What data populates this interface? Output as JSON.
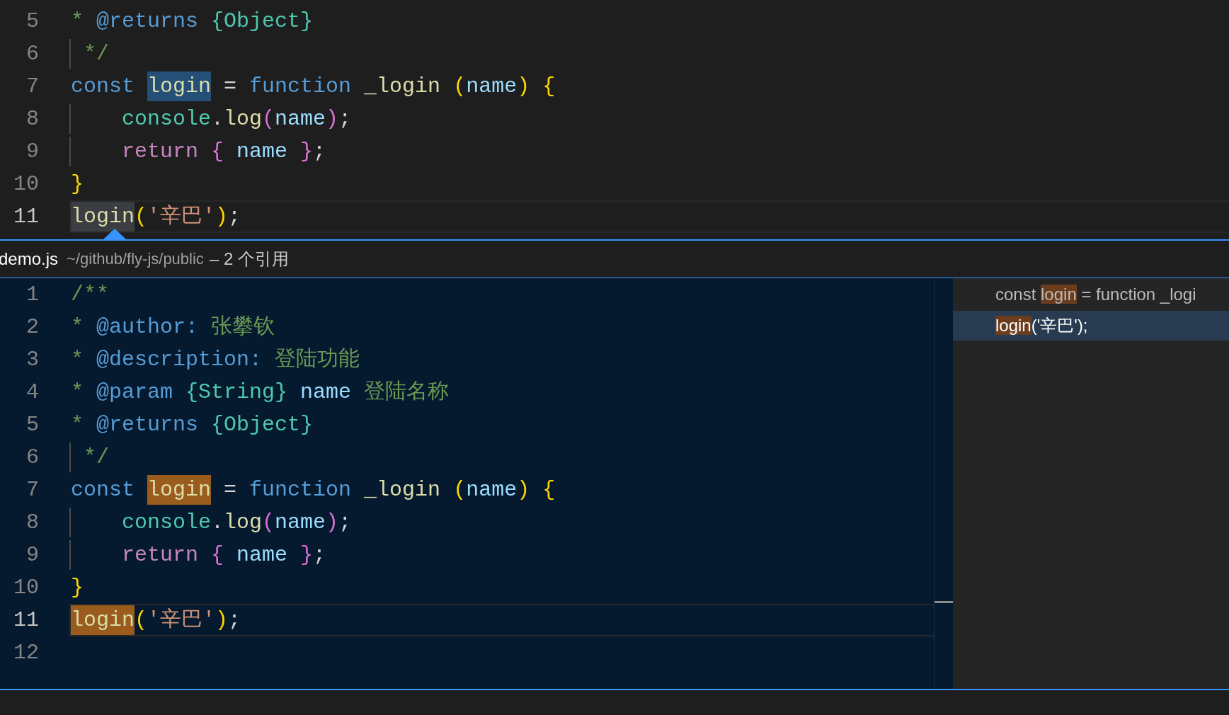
{
  "editor": {
    "lines": [
      {
        "number": "5",
        "current": false,
        "guide": false,
        "tokens": [
          {
            "text": "* ",
            "kind": "comment"
          },
          {
            "text": "@returns",
            "kind": "tag"
          },
          {
            "text": " {Object}",
            "kind": "type"
          }
        ]
      },
      {
        "number": "6",
        "current": false,
        "guide": true,
        "tokens": [
          {
            "text": " */",
            "kind": "comment"
          }
        ]
      },
      {
        "number": "7",
        "current": false,
        "guide": false,
        "tokens": [
          {
            "text": "const ",
            "kind": "keyword"
          },
          {
            "text": "login",
            "kind": "function",
            "selected": true
          },
          {
            "text": " = ",
            "kind": "plain"
          },
          {
            "text": "function ",
            "kind": "keyword"
          },
          {
            "text": "_login ",
            "kind": "function"
          },
          {
            "text": "(",
            "kind": "bracket1"
          },
          {
            "text": "name",
            "kind": "variable"
          },
          {
            "text": ") {",
            "kind": "bracket1"
          }
        ]
      },
      {
        "number": "8",
        "current": false,
        "guide": true,
        "tokens": [
          {
            "text": "    console",
            "kind": "class"
          },
          {
            "text": ".",
            "kind": "plain"
          },
          {
            "text": "log",
            "kind": "function"
          },
          {
            "text": "(",
            "kind": "bracket2"
          },
          {
            "text": "name",
            "kind": "variable"
          },
          {
            "text": ")",
            "kind": "bracket2"
          },
          {
            "text": ";",
            "kind": "plain"
          }
        ]
      },
      {
        "number": "9",
        "current": false,
        "guide": true,
        "tokens": [
          {
            "text": "    return ",
            "kind": "control"
          },
          {
            "text": "{ ",
            "kind": "bracket2"
          },
          {
            "text": "name ",
            "kind": "variable"
          },
          {
            "text": "}",
            "kind": "bracket2"
          },
          {
            "text": ";",
            "kind": "plain"
          }
        ]
      },
      {
        "number": "10",
        "current": false,
        "guide": false,
        "tokens": [
          {
            "text": "}",
            "kind": "bracket1"
          }
        ]
      },
      {
        "number": "11",
        "current": true,
        "guide": false,
        "tokens": [
          {
            "text": "login",
            "kind": "function",
            "highlighted": true
          },
          {
            "text": "(",
            "kind": "bracket1"
          },
          {
            "text": "'辛巴'",
            "kind": "string"
          },
          {
            "text": ")",
            "kind": "bracket1"
          },
          {
            "text": ";",
            "kind": "plain"
          }
        ]
      }
    ]
  },
  "peek": {
    "file": "demo.js",
    "path": "~/github/fly-js/public",
    "summary": "– 2 个引用",
    "editor": {
      "lines": [
        {
          "number": "1",
          "current": false,
          "guide": false,
          "tokens": [
            {
              "text": "/**",
              "kind": "comment"
            }
          ]
        },
        {
          "number": "2",
          "current": false,
          "guide": false,
          "tokens": [
            {
              "text": "* ",
              "kind": "comment"
            },
            {
              "text": "@author:",
              "kind": "tag"
            },
            {
              "text": " 张攀钦",
              "kind": "comment"
            }
          ]
        },
        {
          "number": "3",
          "current": false,
          "guide": false,
          "tokens": [
            {
              "text": "* ",
              "kind": "comment"
            },
            {
              "text": "@description:",
              "kind": "tag"
            },
            {
              "text": " 登陆功能",
              "kind": "comment"
            }
          ]
        },
        {
          "number": "4",
          "current": false,
          "guide": false,
          "tokens": [
            {
              "text": "* ",
              "kind": "comment"
            },
            {
              "text": "@param ",
              "kind": "tag"
            },
            {
              "text": "{String} ",
              "kind": "type"
            },
            {
              "text": "name ",
              "kind": "variable"
            },
            {
              "text": "登陆名称",
              "kind": "comment"
            }
          ]
        },
        {
          "number": "5",
          "current": false,
          "guide": false,
          "tokens": [
            {
              "text": "* ",
              "kind": "comment"
            },
            {
              "text": "@returns",
              "kind": "tag"
            },
            {
              "text": " {Object}",
              "kind": "type"
            }
          ]
        },
        {
          "number": "6",
          "current": false,
          "guide": true,
          "tokens": [
            {
              "text": " */",
              "kind": "comment"
            }
          ]
        },
        {
          "number": "7",
          "current": false,
          "guide": false,
          "tokens": [
            {
              "text": "const ",
              "kind": "keyword"
            },
            {
              "text": "login",
              "kind": "function",
              "highlighted": true
            },
            {
              "text": " = ",
              "kind": "plain"
            },
            {
              "text": "function ",
              "kind": "keyword"
            },
            {
              "text": "_login ",
              "kind": "function"
            },
            {
              "text": "(",
              "kind": "bracket1"
            },
            {
              "text": "name",
              "kind": "variable"
            },
            {
              "text": ") {",
              "kind": "bracket1"
            }
          ]
        },
        {
          "number": "8",
          "current": false,
          "guide": true,
          "tokens": [
            {
              "text": "    console",
              "kind": "class"
            },
            {
              "text": ".",
              "kind": "plain"
            },
            {
              "text": "log",
              "kind": "function"
            },
            {
              "text": "(",
              "kind": "bracket2"
            },
            {
              "text": "name",
              "kind": "variable"
            },
            {
              "text": ")",
              "kind": "bracket2"
            },
            {
              "text": ";",
              "kind": "plain"
            }
          ]
        },
        {
          "number": "9",
          "current": false,
          "guide": true,
          "tokens": [
            {
              "text": "    return ",
              "kind": "control"
            },
            {
              "text": "{ ",
              "kind": "bracket2"
            },
            {
              "text": "name ",
              "kind": "variable"
            },
            {
              "text": "}",
              "kind": "bracket2"
            },
            {
              "text": ";",
              "kind": "plain"
            }
          ]
        },
        {
          "number": "10",
          "current": false,
          "guide": false,
          "tokens": [
            {
              "text": "}",
              "kind": "bracket1"
            }
          ]
        },
        {
          "number": "11",
          "current": true,
          "guide": false,
          "tokens": [
            {
              "text": "login",
              "kind": "function",
              "highlighted": true
            },
            {
              "text": "(",
              "kind": "bracket1"
            },
            {
              "text": "'辛巴'",
              "kind": "string"
            },
            {
              "text": ")",
              "kind": "bracket1"
            },
            {
              "text": ";",
              "kind": "plain"
            }
          ]
        },
        {
          "number": "12",
          "current": false,
          "guide": false
        }
      ]
    },
    "references": [
      {
        "before": "const",
        "match": "login",
        "after": "= function _logi",
        "selected": false
      },
      {
        "match": "login",
        "after": "('辛巴');",
        "selected": true
      }
    ]
  }
}
